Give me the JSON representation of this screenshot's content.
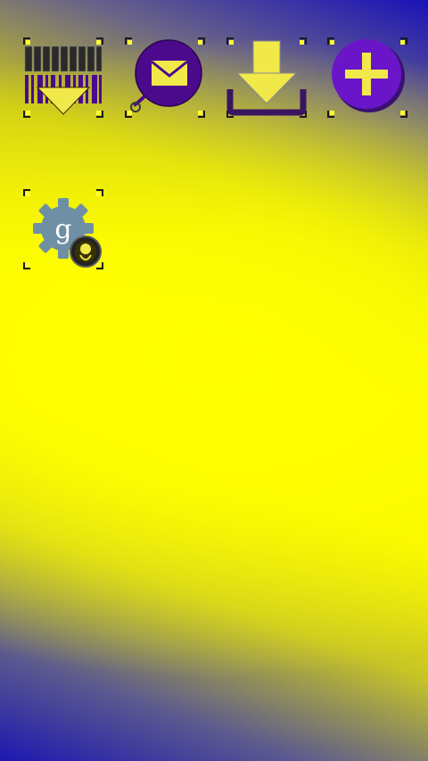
{
  "home_screen": {
    "shortcuts": [
      {
        "id": "barcode-scanner",
        "label": "",
        "icon": "barcode-scanner-icon"
      },
      {
        "id": "messaging",
        "label": "",
        "icon": "mail-bubble-icon"
      },
      {
        "id": "downloads",
        "label": "",
        "icon": "download-icon"
      },
      {
        "id": "add",
        "label": "",
        "icon": "plus-circle-icon"
      },
      {
        "id": "google-settings",
        "label": "",
        "icon": "google-settings-icon"
      }
    ]
  },
  "colors": {
    "wallpaper_yellow": "#f6f400",
    "wallpaper_blue": "#1a12b8",
    "icon_purple": "#4b0a8c",
    "icon_yellow": "#f1e84a",
    "gear_gray": "#6f8fa5"
  }
}
